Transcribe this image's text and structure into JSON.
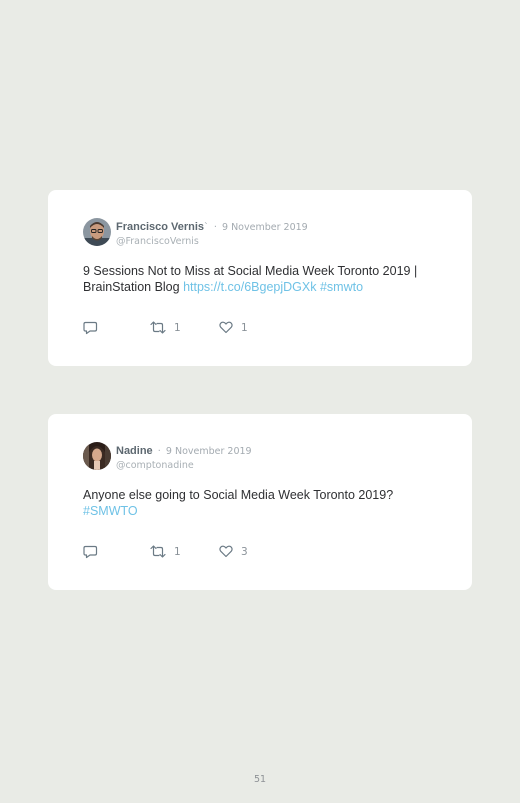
{
  "tweets": [
    {
      "author_name": "Francisco Vernis",
      "author_suffix": "`",
      "separator": "·",
      "date": "9 November 2019",
      "handle": "@FranciscoVernis",
      "text": "9 Sessions Not to Miss at Social Media Week Toronto 2019 | BrainStation Blog",
      "link": "https://t.co/6BgepjDGXk",
      "hashtag": "#smwto",
      "retweets": "1",
      "likes": "1",
      "icons": {
        "reply": "reply-icon",
        "retweet": "retweet-icon",
        "like": "heart-icon"
      }
    },
    {
      "author_name": "Nadine",
      "author_suffix": "",
      "separator": "·",
      "date": "9 November 2019",
      "handle": "@comptonadine",
      "text": "Anyone else going to Social Media Week Toronto 2019?",
      "link": "",
      "hashtag": "#SMWTO",
      "retweets": "1",
      "likes": "3",
      "icons": {
        "reply": "reply-icon",
        "retweet": "retweet-icon",
        "like": "heart-icon"
      }
    }
  ],
  "page_number": "51",
  "colors": {
    "background": "#e9ebe6",
    "card": "#ffffff",
    "link": "#6fc2e6",
    "text": "#2f3033",
    "meta": "#a3aab0"
  }
}
